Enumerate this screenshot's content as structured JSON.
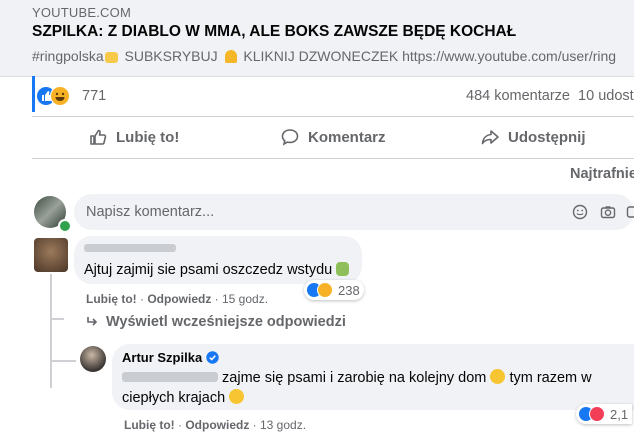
{
  "link_preview": {
    "domain": "YOUTUBE.COM",
    "title": "SZPILKA: Z DIABLO W MMA, ALE BOKS ZAWSZE BĘDĘ KOCHAŁ",
    "desc_tag": "#ringpolska",
    "desc_sub": "SUBKSRYBUJ",
    "desc_bell": "KLIKNIJ DZWONECZEK https://www.youtube.com/user/ring"
  },
  "stats": {
    "reaction_count": "771",
    "comments": "484 komentarze",
    "shares": "10 udost"
  },
  "actions": {
    "like": "Lubię to!",
    "comment": "Komentarz",
    "share": "Udostępnij"
  },
  "sort_label": "Najtrafnie",
  "composer": {
    "placeholder": "Napisz komentarz..."
  },
  "comment1": {
    "text": "Ajtuj zajmij sie psami oszczedz wstydu",
    "reactions": "238",
    "like": "Lubię to!",
    "reply": "Odpowiedz",
    "time": "15 godz."
  },
  "view_previous": "Wyświetl wcześniejsze odpowiedzi",
  "reply1": {
    "author": "Artur Szpilka",
    "text_line1": "zajme się psami i zarobię na kolejny dom",
    "text_line1b": "tym razem w",
    "text_line2": "ciepłych krajach",
    "reactions": "2,1",
    "like": "Lubię to!",
    "reply": "Odpowiedz",
    "time": "13 godz."
  },
  "colors": {
    "accent": "#1877f2",
    "muted": "#65676b",
    "bubble": "#f0f2f5"
  }
}
